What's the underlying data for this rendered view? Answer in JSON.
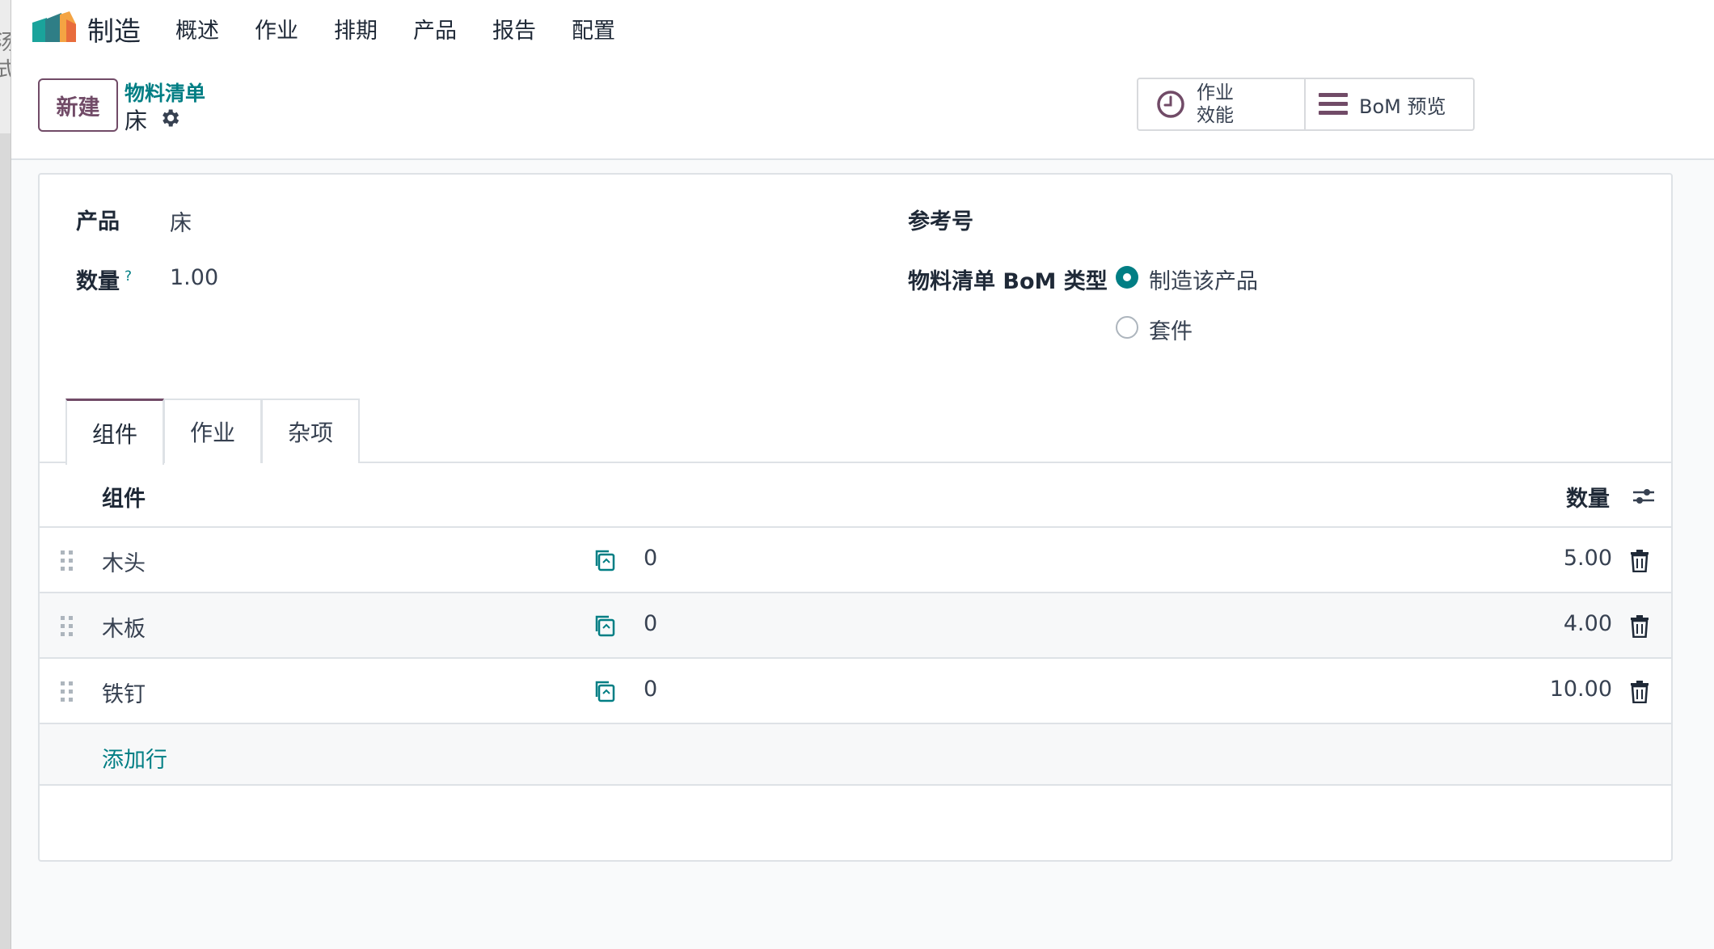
{
  "navbar": {
    "app_name": "制造",
    "menu": [
      "概述",
      "作业",
      "排期",
      "产品",
      "报告",
      "配置"
    ]
  },
  "control_panel": {
    "new_button": "新建",
    "breadcrumb": "物料清单",
    "record_name": "床",
    "smart_buttons": {
      "operations_line1": "作业",
      "operations_line2": "效能",
      "bom_overview": "BoM 预览"
    }
  },
  "form": {
    "product_label": "产品",
    "product_value": "床",
    "quantity_label": "数量",
    "quantity_help": "?",
    "quantity_value": "1.00",
    "reference_label": "参考号",
    "bom_type_label": "物料清单 BoM 类型",
    "bom_type_options": [
      {
        "label": "制造该产品",
        "selected": true
      },
      {
        "label": "套件",
        "selected": false
      }
    ]
  },
  "tabs": [
    "组件",
    "作业",
    "杂项"
  ],
  "components_table": {
    "headers": {
      "component": "组件",
      "quantity": "数量"
    },
    "rows": [
      {
        "component": "木头",
        "forecast": "0",
        "quantity": "5.00"
      },
      {
        "component": "木板",
        "forecast": "0",
        "quantity": "4.00"
      },
      {
        "component": "铁钉",
        "forecast": "0",
        "quantity": "10.00"
      }
    ],
    "add_line": "添加行"
  },
  "colors": {
    "brand": "#714b67",
    "accent": "#017e84"
  },
  "icons": [
    "app-logo-icon",
    "gear-icon",
    "clock-icon",
    "list-icon",
    "copy-icon",
    "drag-handle-icon",
    "trash-icon",
    "column-settings-icon"
  ]
}
